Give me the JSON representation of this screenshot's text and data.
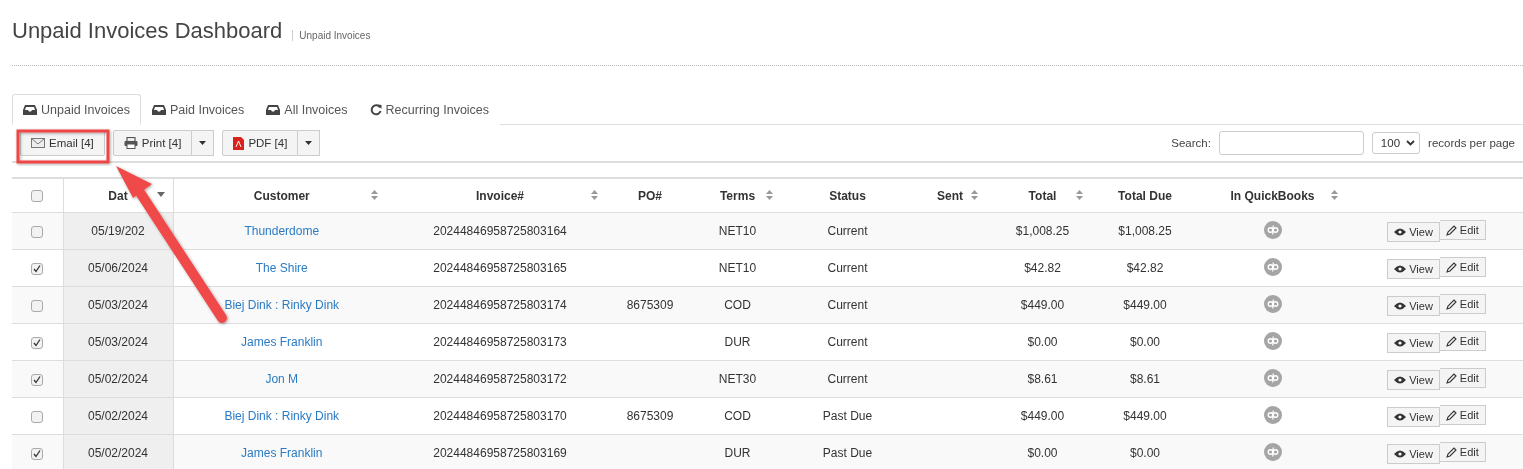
{
  "page": {
    "title": "Unpaid Invoices Dashboard",
    "breadcrumb": "Unpaid Invoices"
  },
  "tabs": [
    {
      "label": "Unpaid Invoices",
      "selected": true
    },
    {
      "label": "Paid Invoices",
      "selected": false
    },
    {
      "label": "All Invoices",
      "selected": false
    },
    {
      "label": "Recurring Invoices",
      "selected": false
    }
  ],
  "toolbar": {
    "buttons": [
      {
        "label": "Email [4]",
        "dropdown": false
      },
      {
        "label": "Print [4]",
        "dropdown": true
      },
      {
        "label": "PDF [4]",
        "dropdown": true
      }
    ],
    "search_label": "Search:",
    "page_size": "100",
    "page_size_label": "records per page"
  },
  "table": {
    "select_all_checked": false,
    "columns": [
      {
        "label": "Dat",
        "kind": "text",
        "sorted": true
      },
      {
        "label": "Customer",
        "kind": "link",
        "sortable": true,
        "sorted": false
      },
      {
        "label": "Invoice#",
        "kind": "text",
        "sortable": true,
        "sorted": false
      },
      {
        "label": "PO#",
        "kind": "text",
        "sortable": false,
        "sorted": false
      },
      {
        "label": "Terms",
        "kind": "text",
        "sortable": true,
        "sorted": false
      },
      {
        "label": "Status",
        "kind": "text",
        "sortable": false,
        "sorted": false
      },
      {
        "label": "Sent",
        "kind": "text",
        "sortable": true,
        "sorted": false
      },
      {
        "label": "Total",
        "kind": "text",
        "sortable": true,
        "sorted": false
      },
      {
        "label": "Total Due",
        "kind": "text",
        "sortable": false,
        "sorted": false
      },
      {
        "label": "In QuickBooks",
        "kind": "qb",
        "sortable": true,
        "sorted": false
      }
    ],
    "rows": [
      {
        "checked": false,
        "cells": [
          "05/19/202",
          "Thunderdome",
          "20244846958725803164",
          "",
          "NET10",
          "Current",
          "",
          "$1,008.25",
          "$1,008.25"
        ],
        "actions": [
          "View",
          "Edit"
        ]
      },
      {
        "checked": true,
        "cells": [
          "05/06/2024",
          "The Shire",
          "20244846958725803165",
          "",
          "NET10",
          "Current",
          "",
          "$42.82",
          "$42.82"
        ],
        "actions": [
          "View",
          "Edit"
        ]
      },
      {
        "checked": false,
        "cells": [
          "05/03/2024",
          "Biej Dink : Rinky Dink",
          "20244846958725803174",
          "8675309",
          "COD",
          "Current",
          "",
          "$449.00",
          "$449.00"
        ],
        "actions": [
          "View",
          "Edit"
        ]
      },
      {
        "checked": true,
        "cells": [
          "05/03/2024",
          "James Franklin",
          "20244846958725803173",
          "",
          "DUR",
          "Current",
          "",
          "$0.00",
          "$0.00"
        ],
        "actions": [
          "View",
          "Edit"
        ]
      },
      {
        "checked": true,
        "cells": [
          "05/02/2024",
          "Jon M",
          "20244846958725803172",
          "",
          "NET30",
          "Current",
          "",
          "$8.61",
          "$8.61"
        ],
        "actions": [
          "View",
          "Edit"
        ]
      },
      {
        "checked": false,
        "cells": [
          "05/02/2024",
          "Biej Dink : Rinky Dink",
          "20244846958725803170",
          "8675309",
          "COD",
          "Past Due",
          "",
          "$449.00",
          "$449.00"
        ],
        "actions": [
          "View",
          "Edit"
        ]
      },
      {
        "checked": true,
        "cells": [
          "05/02/2024",
          "James Franklin",
          "20244846958725803169",
          "",
          "DUR",
          "Past Due",
          "",
          "$0.00",
          "$0.00"
        ],
        "actions": [
          "View",
          "Edit"
        ]
      }
    ]
  }
}
